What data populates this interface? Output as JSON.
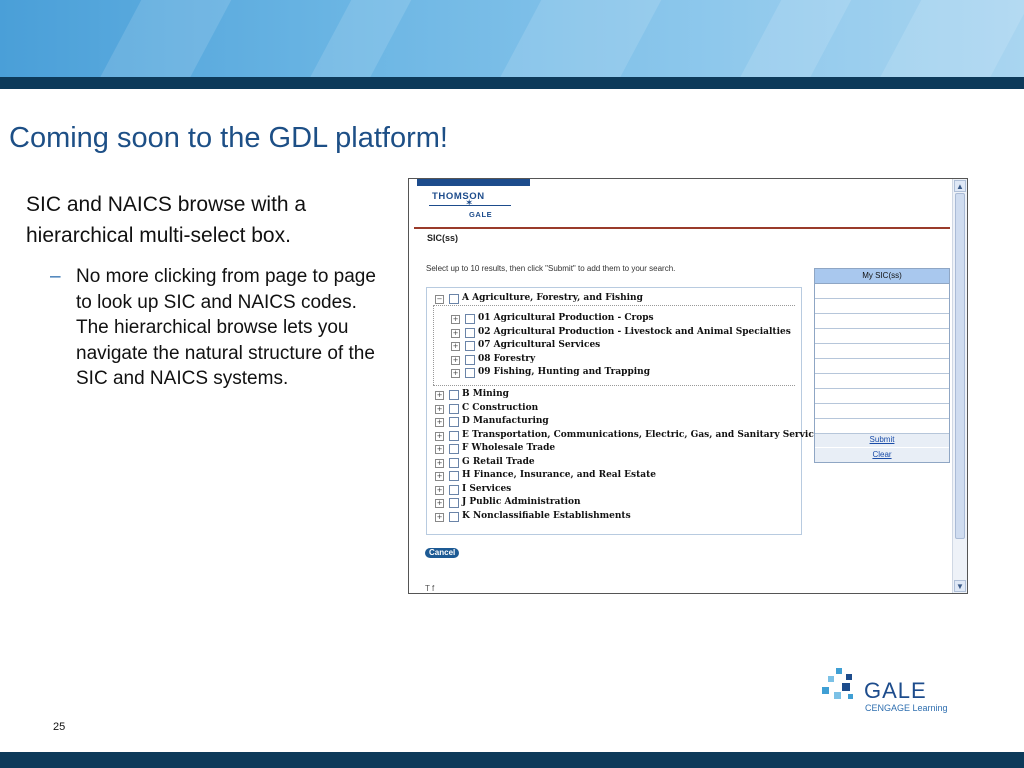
{
  "slide": {
    "title": "Coming soon to the GDL platform!",
    "intro": "SIC and NAICS browse with a hierarchical multi-select box.",
    "bullet_marker": "–",
    "bullet": "No more clicking from page to page to look up SIC and NAICS codes. The hierarchical browse lets you navigate the natural structure of the SIC and NAICS systems.",
    "page_number": "25"
  },
  "screenshot": {
    "logo_line1": "THOMSON",
    "logo_line2": "GALE",
    "heading": "SIC(ss)",
    "instructions": "Select up to 10 results, then click \"Submit\" to add them to your search.",
    "tree": {
      "expanded_parent": "A Agriculture, Forestry, and Fishing",
      "expanded_children": [
        "01 Agricultural Production - Crops",
        "02 Agricultural Production - Livestock and Animal Specialties",
        "07 Agricultural Services",
        "08 Forestry",
        "09 Fishing, Hunting and Trapping"
      ],
      "collapsed_items": [
        "B Mining",
        "C Construction",
        "D Manufacturing",
        "E Transportation, Communications, Electric, Gas, and Sanitary Services",
        "F Wholesale Trade",
        "G Retail Trade",
        "H Finance, Insurance, and Real Estate",
        "I Services",
        "J Public Administration",
        "K Nonclassifiable Establishments"
      ],
      "expand_glyph": "+",
      "collapse_glyph": "−"
    },
    "my_box": {
      "header": "My  SIC(ss)",
      "submit": "Submit",
      "clear": "Clear"
    },
    "cancel": "Cancel",
    "footer_partial": "T     f",
    "scroll_up": "▲",
    "scroll_down": "▼"
  },
  "logo": {
    "word": "GALE",
    "sub": "CENGAGE Learning"
  },
  "colors": {
    "title": "#1d4f86",
    "banner_dark": "#0d3a5a",
    "link": "#1a4ca8"
  }
}
